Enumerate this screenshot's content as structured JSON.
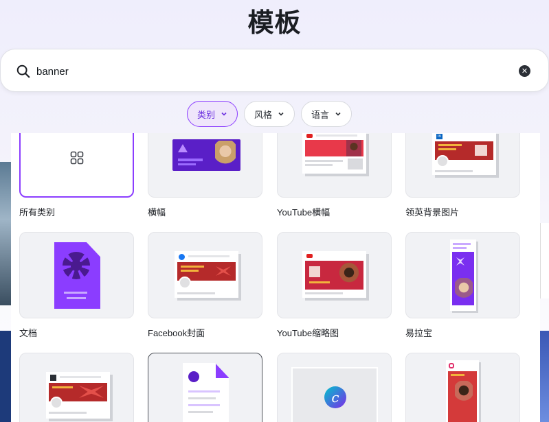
{
  "header": {
    "title": "模板"
  },
  "search": {
    "value": "banner",
    "clear_icon": "close-icon"
  },
  "filters": [
    {
      "label": "类别",
      "active": true
    },
    {
      "label": "风格",
      "active": false
    },
    {
      "label": "语言",
      "active": false
    }
  ],
  "categories": [
    {
      "label": "所有类别",
      "icon": "grid-icon",
      "selected": true
    },
    {
      "label": "横幅",
      "icon": "banner-thumbnail"
    },
    {
      "label": "YouTube横幅",
      "icon": "youtube-banner-thumbnail"
    },
    {
      "label": "领英背景图片",
      "icon": "linkedin-background-thumbnail"
    },
    {
      "label": "文档",
      "icon": "document-thumbnail"
    },
    {
      "label": "Facebook封面",
      "icon": "facebook-cover-thumbnail"
    },
    {
      "label": "YouTube缩略图",
      "icon": "youtube-thumbnail-thumbnail"
    },
    {
      "label": "易拉宝",
      "icon": "rollup-banner-thumbnail"
    },
    {
      "label": "",
      "icon": "twitch-banner-thumbnail"
    },
    {
      "label": "",
      "icon": "document-thumbnail"
    },
    {
      "label": "",
      "icon": "canva-logo-thumbnail"
    },
    {
      "label": "",
      "icon": "instagram-story-thumbnail"
    }
  ],
  "colors": {
    "accent": "#8b3dff",
    "brand_red": "#c22a2a",
    "purple_card": "#7a2ff0"
  }
}
